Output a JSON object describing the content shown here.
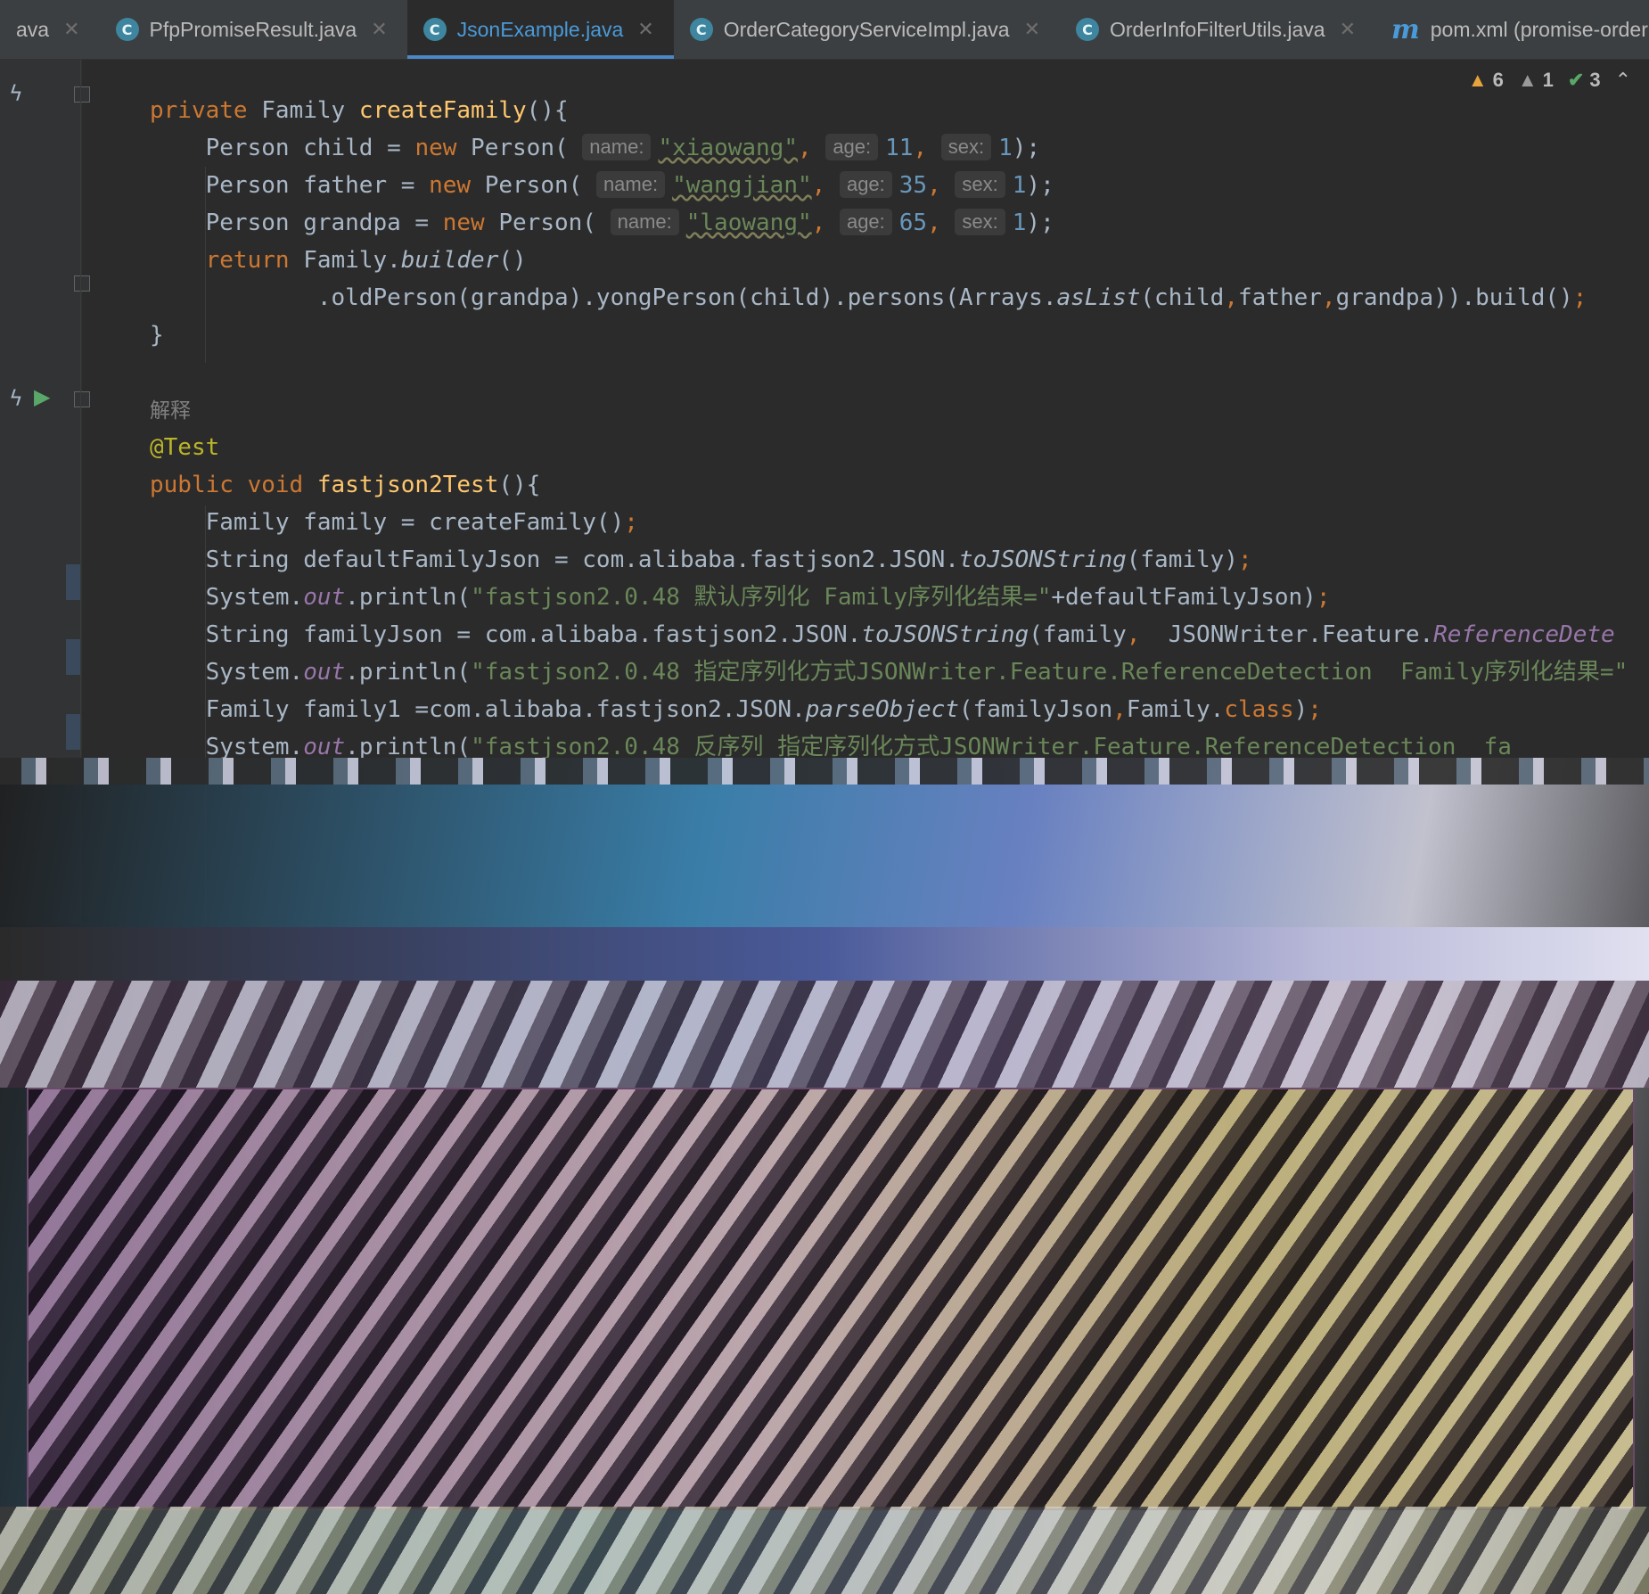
{
  "tabs": [
    {
      "label": "ava",
      "icon": "none",
      "active": false
    },
    {
      "label": "PfpPromiseResult.java",
      "icon": "class-icon",
      "active": false
    },
    {
      "label": "JsonExample.java",
      "icon": "class-icon",
      "active": true
    },
    {
      "label": "OrderCategoryServiceImpl.java",
      "icon": "class-icon",
      "active": false
    },
    {
      "label": "OrderInfoFilterUtils.java",
      "icon": "class-icon",
      "active": false
    },
    {
      "label": "pom.xml (promise-ordermarking",
      "icon": "maven-icon",
      "active": false
    }
  ],
  "inspections": {
    "warnings": "6",
    "weak_warnings": "1",
    "ok": "3"
  },
  "code": {
    "l1": {
      "kw": "private",
      "type": "Family",
      "fn": "createFamily",
      "rest": "(){"
    },
    "l2": {
      "pre": "Person child = ",
      "kw": "new",
      "cls": " Person(",
      "h_name": "name:",
      "s": "\"xiaowang\"",
      "h_age": "age:",
      "age": "11",
      "h_sex": "sex:",
      "sex": "1",
      "end": ");"
    },
    "l3": {
      "pre": "Person father = ",
      "kw": "new",
      "cls": " Person(",
      "h_name": "name:",
      "s": "\"wangjian\"",
      "h_age": "age:",
      "age": "35",
      "h_sex": "sex:",
      "sex": "1",
      "end": ");"
    },
    "l4": {
      "pre": "Person grandpa = ",
      "kw": "new",
      "cls": " Person(",
      "h_name": "name:",
      "s": "\"laowang\"",
      "h_age": "age:",
      "age": "65",
      "h_sex": "sex:",
      "sex": "1",
      "end": ");"
    },
    "l5": {
      "kw": "return",
      "a": " Family.",
      "m": "builder",
      "b": "()"
    },
    "l6": {
      "a": ".oldPerson(grandpa).yongPerson(child).persons(Arrays.",
      "m": "asList",
      "b": "(child",
      "c1": ",",
      "d": "father",
      "c2": ",",
      "e": "grandpa)).build()",
      "end": ";"
    },
    "l7": "}",
    "comment": "解释",
    "annotation": "@Test",
    "l10": {
      "kw1": "public",
      "kw2": "void",
      "fn": "fastjson2Test",
      "rest": "(){"
    },
    "l11": {
      "a": "Family family = createFamily()",
      "end": ";"
    },
    "l12": {
      "a": "String defaultFamilyJson = com.alibaba.fastjson2.JSON.",
      "m": "toJSONString",
      "b": "(family)",
      "end": ";"
    },
    "l13": {
      "a": "System.",
      "f": "out",
      "b": ".println(",
      "s": "\"fastjson2.0.48 默认序列化 Family序列化结果=\"",
      "c": "+defaultFamilyJson)",
      "end": ";"
    },
    "l14": {
      "a": "String familyJson = com.alibaba.fastjson2.JSON.",
      "m": "toJSONString",
      "b": "(family",
      "c": ",",
      "d": "  JSONWriter.Feature.",
      "f": "ReferenceDete"
    },
    "l15": {
      "a": "System.",
      "f": "out",
      "b": ".println(",
      "s": "\"fastjson2.0.48 指定序列化方式JSONWriter.Feature.ReferenceDetection  Family序列化结果=\""
    },
    "l16": {
      "a": "Family family1 =com.alibaba.fastjson2.JSON.",
      "m": "parseObject",
      "b": "(familyJson",
      "c": ",",
      "d": "Family.",
      "kw": "class",
      "e": ")",
      "end": ";"
    },
    "l17": {
      "a": "System.",
      "f": "out",
      "b": ".println(",
      "s": "\"fastjson2.0.48 反序列 指定序列化方式JSONWriter.Feature.ReferenceDetection  fa"
    }
  },
  "colors": {
    "keyword": "#cc7832",
    "function": "#ffc66d",
    "string": "#6a8759",
    "number": "#6897bb",
    "annotation": "#bbb529",
    "field": "#9876aa",
    "accent": "#4a9ad9"
  }
}
